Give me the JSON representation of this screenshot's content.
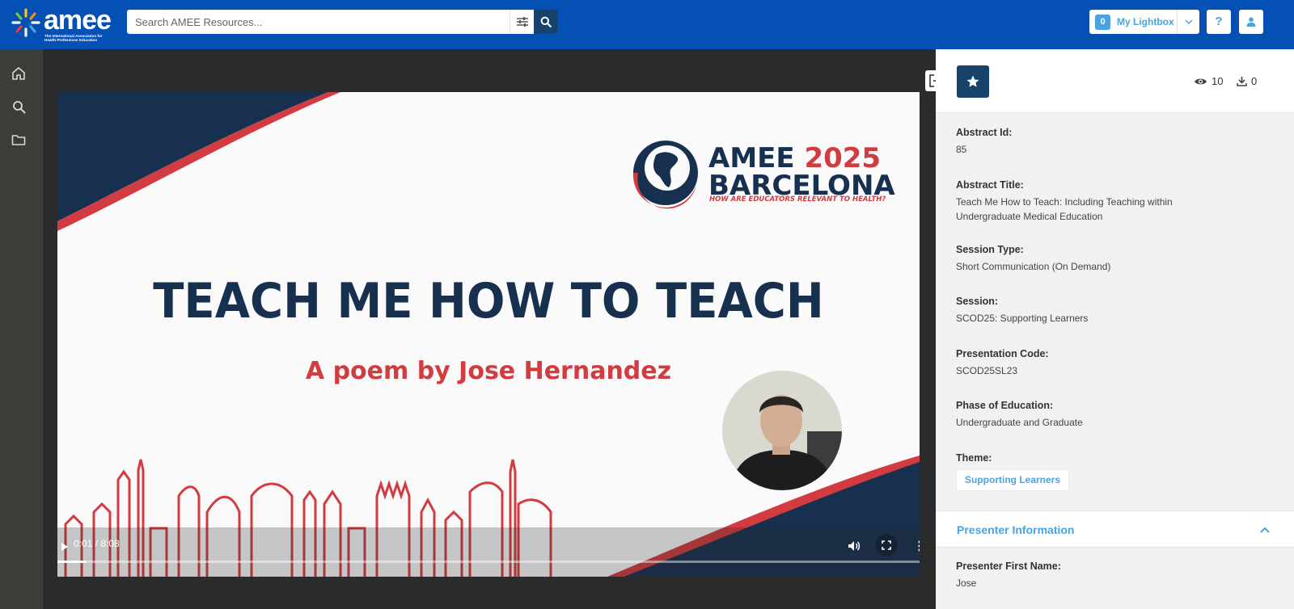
{
  "header": {
    "logo_text": "amee",
    "logo_tagline": "The International Association for Health Professions Education",
    "search_placeholder": "Search AMEE Resources...",
    "lightbox_count": "0",
    "lightbox_label": "My Lightbox",
    "help_label": "?"
  },
  "rail": {
    "items": [
      "home-icon",
      "search-icon",
      "folder-icon"
    ]
  },
  "video": {
    "slide": {
      "brand_prefix": "AMEE ",
      "brand_year": "2025",
      "brand_city": "BARCELONA",
      "brand_tagline": "HOW ARE EDUCATORS RELEVANT TO HEALTH?",
      "title": "TEACH ME HOW TO TEACH",
      "subtitle": "A poem by Jose Hernandez"
    },
    "timecode": "0:01 / 8:08",
    "progress_fraction": 0.002,
    "colors": {
      "navy": "#17304f",
      "red": "#d23b3f"
    }
  },
  "panel": {
    "views": "10",
    "downloads": "0",
    "fields": [
      {
        "label": "Abstract Id:",
        "value": "85"
      },
      {
        "label": "Abstract Title:",
        "value": "Teach Me How to Teach: Including Teaching within Undergraduate Medical Education"
      },
      {
        "label": "Session Type:",
        "value": "Short Communication (On Demand)"
      },
      {
        "label": "Session:",
        "value": "SCOD25: Supporting Learners"
      },
      {
        "label": "Presentation Code:",
        "value": "SCOD25SL23"
      },
      {
        "label": "Phase of Education:",
        "value": "Undergraduate and Graduate"
      },
      {
        "label": "Theme:",
        "value": ""
      }
    ],
    "theme_tag": "Supporting Learners",
    "presenter_section_title": "Presenter Information",
    "presenter_fields": [
      {
        "label": "Presenter First Name:",
        "value": "Jose"
      }
    ]
  }
}
